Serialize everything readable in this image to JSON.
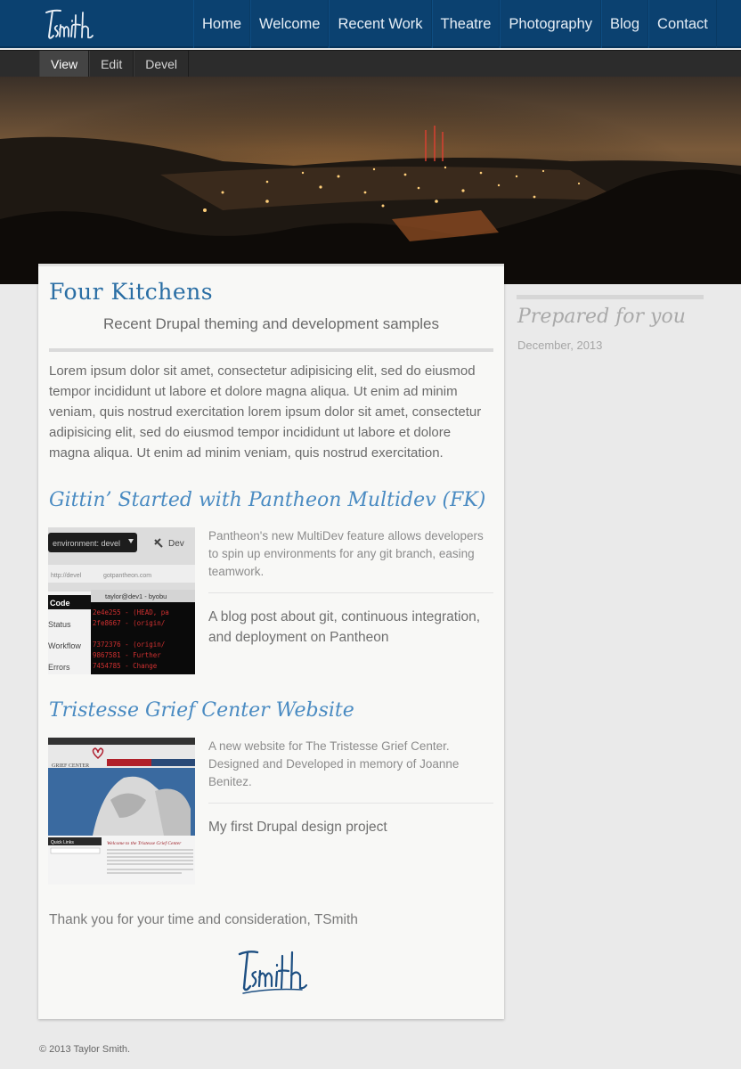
{
  "header": {
    "logo_text": "tsmith",
    "nav": [
      "Home",
      "Welcome",
      "Recent Work",
      "Theatre",
      "Photography",
      "Blog",
      "Contact"
    ]
  },
  "tabs": [
    {
      "label": "View",
      "active": true
    },
    {
      "label": "Edit",
      "active": false
    },
    {
      "label": "Devel",
      "active": false
    }
  ],
  "main": {
    "title": "Four Kitchens",
    "subtitle": "Recent Drupal theming and development samples",
    "intro": "Lorem ipsum dolor sit amet, consectetur adipisicing elit, sed do eiusmod tempor incididunt ut labore et dolore magna aliqua. Ut enim ad minim veniam, quis nostrud exercitation lorem ipsum dolor sit amet, consectetur adipisicing elit, sed do eiusmod tempor incididunt ut labore et dolore magna aliqua. Ut enim ad minim veniam, quis nostrud exercitation.",
    "projects": [
      {
        "title": "Gittin’ Started with Pantheon Multidev (FK)",
        "description": "Pantheon's new MultiDev feature allows developers to spin up environments for any git branch, easing teamwork.",
        "note": "A blog post about git, continuous integration, and deployment on Pantheon",
        "thumb": {
          "env_label": "environment: devel",
          "dev_label": "Dev",
          "url_left": "http://devel",
          "url_right": "gotpantheon.com",
          "terminal_title": "taylor@dev1 - byobu",
          "menu": [
            "Code",
            "Status",
            "Workflow",
            "Errors"
          ],
          "terminal_lines": [
            "2e4e255 - (HEAD, pa",
            "  2fe8667 - (origin/",
            "",
            "  7372376 - (origin/",
            "  9867581 - Further",
            "  7454785 - Change"
          ]
        }
      },
      {
        "title": "Tristesse Grief Center Website",
        "description": "A new website for The Tristesse Grief Center. Designed and Developed in memory of Joanne Benitez.",
        "note": "My first Drupal design project",
        "thumb": {
          "brand": "GRIEF CENTER",
          "welcome": "Welcome to the Tristesse Grief Center",
          "quick_links": "Quick Links"
        }
      }
    ],
    "thanks": "Thank you for your time and consideration, TSmith",
    "signature_text": "tsmith"
  },
  "sidebar": {
    "title": "Prepared for you",
    "date": "December, 2013"
  },
  "footer": {
    "copyright": "© 2013 Taylor Smith."
  }
}
